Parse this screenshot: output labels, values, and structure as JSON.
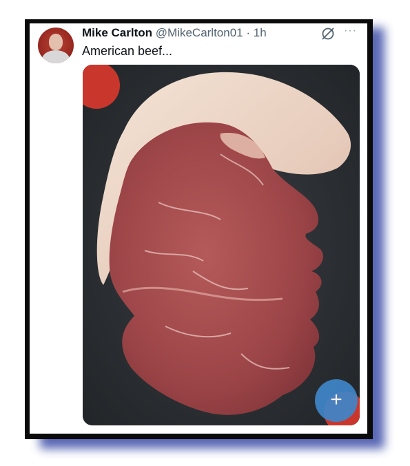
{
  "post": {
    "author_name": "Mike Carlton",
    "handle": "@MikeCarlton01",
    "separator": "·",
    "time": "1h",
    "text": "American beef..."
  },
  "icons": {
    "grok": "grok-icon",
    "more": "more-icon",
    "compose": "plus-icon"
  },
  "compose_label": "+",
  "more_label": "···",
  "colors": {
    "frame": "#0b0b0b",
    "shadow": "#3d4ea8",
    "fab": "#3f86c9",
    "text": "#0f1419",
    "secondary_text": "#536471"
  }
}
